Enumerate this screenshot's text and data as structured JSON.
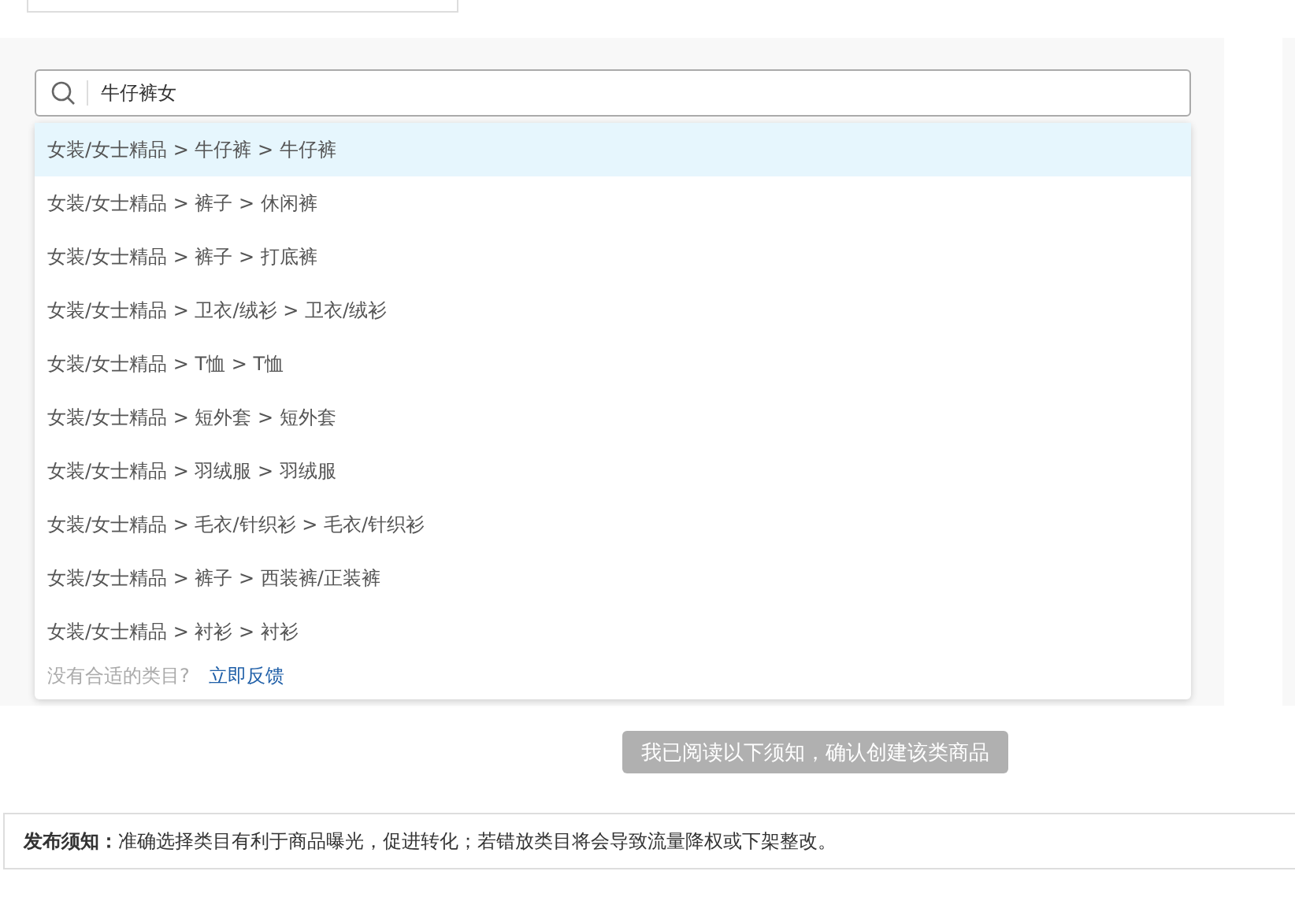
{
  "search": {
    "value": "牛仔裤女"
  },
  "suggestions": [
    {
      "label": "女装/女士精品 > 牛仔裤 > 牛仔裤",
      "selected": true
    },
    {
      "label": "女装/女士精品 > 裤子 > 休闲裤",
      "selected": false
    },
    {
      "label": "女装/女士精品 > 裤子 > 打底裤",
      "selected": false
    },
    {
      "label": "女装/女士精品 > 卫衣/绒衫 > 卫衣/绒衫",
      "selected": false
    },
    {
      "label": "女装/女士精品 > T恤 > T恤",
      "selected": false
    },
    {
      "label": "女装/女士精品 > 短外套 > 短外套",
      "selected": false
    },
    {
      "label": "女装/女士精品 > 羽绒服 > 羽绒服",
      "selected": false
    },
    {
      "label": "女装/女士精品 > 毛衣/针织衫 > 毛衣/针织衫",
      "selected": false
    },
    {
      "label": "女装/女士精品 > 裤子 > 西装裤/正装裤",
      "selected": false
    },
    {
      "label": "女装/女士精品 > 衬衫 > 衬衫",
      "selected": false
    }
  ],
  "feedback": {
    "prompt": "没有合适的类目?",
    "link": "立即反馈"
  },
  "confirm_button": {
    "label": "我已阅读以下须知，确认创建该类商品",
    "disabled": true
  },
  "notice": "**发布须知：**准确选择类目有利于商品曝光，促进转化；若错放类目将会导致流量降权或下架整改。"
}
